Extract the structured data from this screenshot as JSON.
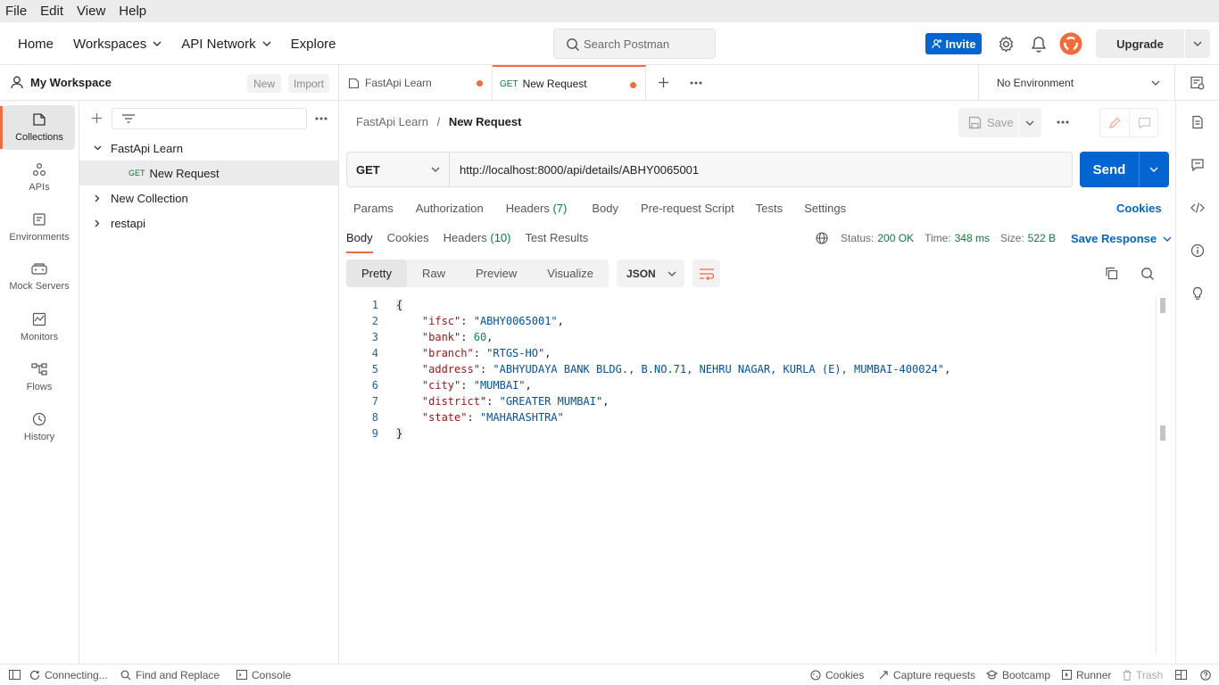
{
  "menu": [
    "File",
    "Edit",
    "View",
    "Help"
  ],
  "topnav": {
    "home": "Home",
    "workspaces": "Workspaces",
    "api_network": "API Network",
    "explore": "Explore",
    "search_placeholder": "Search Postman",
    "invite": "Invite",
    "upgrade": "Upgrade"
  },
  "sidebar": {
    "workspace_name": "My Workspace",
    "new_label": "New",
    "import_label": "Import",
    "rail": [
      {
        "label": "Collections",
        "icon": "collections-icon",
        "active": true
      },
      {
        "label": "APIs",
        "icon": "apis-icon"
      },
      {
        "label": "Environments",
        "icon": "environments-icon"
      },
      {
        "label": "Mock Servers",
        "icon": "mock-servers-icon"
      },
      {
        "label": "Monitors",
        "icon": "monitors-icon"
      },
      {
        "label": "Flows",
        "icon": "flows-icon"
      },
      {
        "label": "History",
        "icon": "history-icon"
      }
    ],
    "tree": [
      {
        "label": "FastApi Learn",
        "expanded": true
      },
      {
        "method": "GET",
        "label": "New Request",
        "selected": true
      },
      {
        "label": "New Collection",
        "expanded": false
      },
      {
        "label": "restapi",
        "expanded": false
      }
    ]
  },
  "tabs": [
    {
      "label": "FastApi Learn",
      "unsaved": true
    },
    {
      "method": "GET",
      "label": "New Request",
      "unsaved": true,
      "active": true
    }
  ],
  "environment": "No Environment",
  "request": {
    "breadcrumb_parent": "FastApi Learn",
    "breadcrumb_sep": "/",
    "breadcrumb_current": "New Request",
    "save_label": "Save",
    "method": "GET",
    "url": "http://localhost:8000/api/details/ABHY0065001",
    "send_label": "Send",
    "tabs": {
      "params": "Params",
      "authorization": "Authorization",
      "headers": "Headers",
      "headers_count": "(7)",
      "body": "Body",
      "pre_request": "Pre-request Script",
      "tests": "Tests",
      "settings": "Settings",
      "cookies": "Cookies"
    }
  },
  "response": {
    "tabs": {
      "body": "Body",
      "cookies": "Cookies",
      "headers": "Headers",
      "headers_count": "(10)",
      "test_results": "Test Results"
    },
    "status_label": "Status:",
    "status_value": "200 OK",
    "time_label": "Time:",
    "time_value": "348 ms",
    "size_label": "Size:",
    "size_value": "522 B",
    "save_response": "Save Response",
    "view_modes": [
      "Pretty",
      "Raw",
      "Preview",
      "Visualize"
    ],
    "format": "JSON",
    "lines": [
      {
        "num": "1",
        "text": "{"
      },
      {
        "num": "2",
        "key": "\"ifsc\"",
        "value": "\"ABHY0065001\"",
        "type": "string",
        "comma": ","
      },
      {
        "num": "3",
        "key": "\"bank\"",
        "value": "60",
        "type": "number",
        "comma": ","
      },
      {
        "num": "4",
        "key": "\"branch\"",
        "value": "\"RTGS-HO\"",
        "type": "string",
        "comma": ","
      },
      {
        "num": "5",
        "key": "\"address\"",
        "value": "\"ABHYUDAYA BANK BLDG., B.NO.71, NEHRU NAGAR, KURLA (E), MUMBAI-400024\"",
        "type": "string",
        "comma": ","
      },
      {
        "num": "6",
        "key": "\"city\"",
        "value": "\"MUMBAI\"",
        "type": "string",
        "comma": ","
      },
      {
        "num": "7",
        "key": "\"district\"",
        "value": "\"GREATER MUMBAI\"",
        "type": "string",
        "comma": ","
      },
      {
        "num": "8",
        "key": "\"state\"",
        "value": "\"MAHARASHTRA\"",
        "type": "string",
        "comma": ""
      },
      {
        "num": "9",
        "text": "}"
      }
    ]
  },
  "statusbar": {
    "connecting": "Connecting...",
    "find_replace": "Find and Replace",
    "console": "Console",
    "cookies": "Cookies",
    "capture": "Capture requests",
    "bootcamp": "Bootcamp",
    "runner": "Runner",
    "trash": "Trash"
  },
  "colors": {
    "accent": "#f26b3a",
    "primary": "#0265d2",
    "status_ok": "#0b7a38"
  }
}
